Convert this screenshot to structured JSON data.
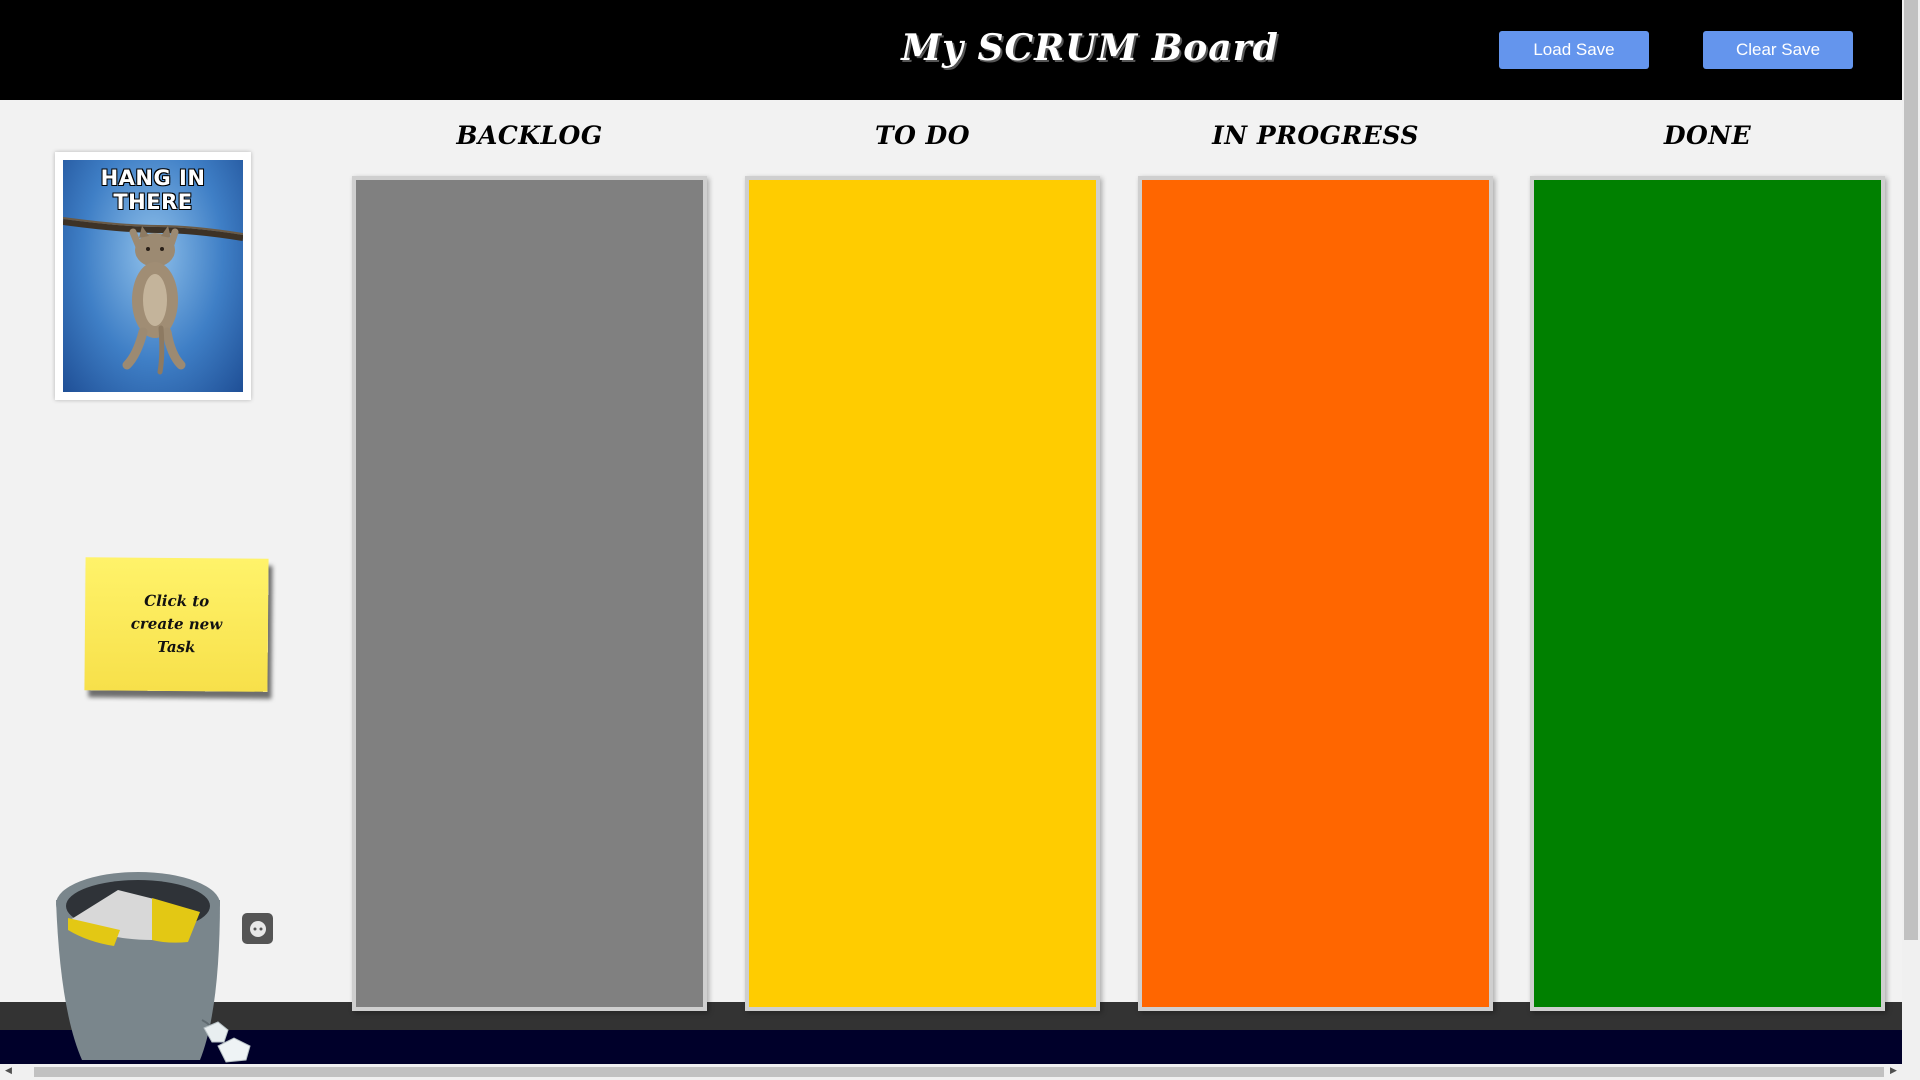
{
  "header": {
    "title": "My SCRUM Board",
    "load_label": "Load Save",
    "clear_label": "Clear Save"
  },
  "poster": {
    "caption": "HANG IN THERE",
    "icon": "kitten-hanging-on-branch"
  },
  "new_task": {
    "label": "Click to create new Task"
  },
  "columns": [
    {
      "title": "BACKLOG",
      "color": "#808080"
    },
    {
      "title": "TO DO",
      "color": "#ffcc00"
    },
    {
      "title": "IN PROGRESS",
      "color": "#ff6600"
    },
    {
      "title": "DONE",
      "color": "#008000"
    }
  ],
  "icons": {
    "trash": "trash-bin-icon",
    "outlet": "power-outlet-icon"
  },
  "colors": {
    "topbar": "#000000",
    "button": "#6495ed",
    "background": "#f2f2f2",
    "sticky": "#f7e04a"
  }
}
